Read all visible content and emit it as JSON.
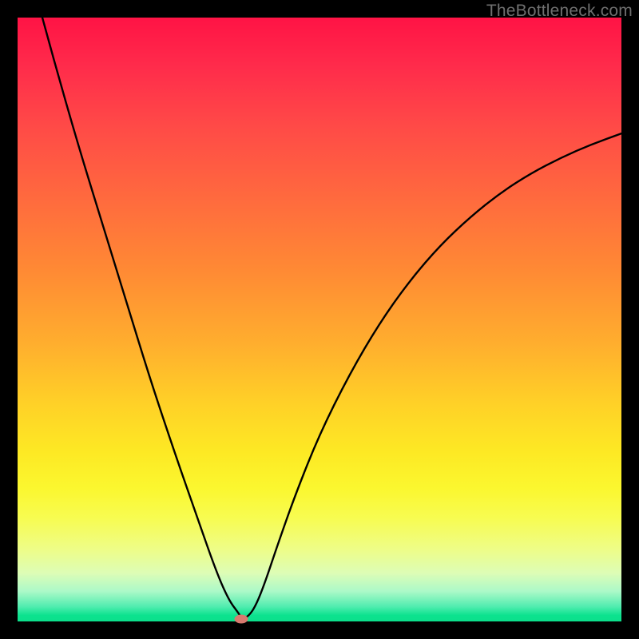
{
  "attribution": "TheBottleneck.com",
  "colors": {
    "frame_bg_top": "#ff1345",
    "frame_bg_bottom": "#0ce08c",
    "curve_stroke": "#000000",
    "marker_fill": "#d77a6f",
    "page_bg": "#000000",
    "attribution_text": "#6f6f6f"
  },
  "chart_data": {
    "type": "line",
    "title": "",
    "xlabel": "",
    "ylabel": "",
    "xlim": [
      0,
      100
    ],
    "ylim": [
      0,
      100
    ],
    "grid": false,
    "legend": false,
    "annotations": [],
    "series": [
      {
        "name": "curve",
        "x": [
          4.1,
          6.0,
          10.0,
          14.0,
          18.0,
          22.0,
          26.0,
          30.0,
          33.0,
          35.0,
          36.5,
          37.2,
          38.3,
          39.5,
          41.0,
          43.0,
          46.0,
          50.0,
          55.0,
          60.0,
          65.0,
          70.0,
          75.0,
          80.0,
          85.0,
          90.0,
          95.0,
          100.0
        ],
        "y": [
          100.0,
          93.0,
          79.0,
          66.0,
          53.0,
          40.0,
          28.0,
          16.5,
          8.0,
          3.5,
          1.5,
          0.4,
          0.9,
          2.7,
          6.5,
          12.5,
          21.0,
          31.0,
          41.0,
          49.5,
          56.5,
          62.3,
          67.0,
          71.0,
          74.2,
          76.8,
          79.0,
          80.8
        ]
      }
    ],
    "marker": {
      "x": 37.0,
      "y": 0.4
    }
  }
}
